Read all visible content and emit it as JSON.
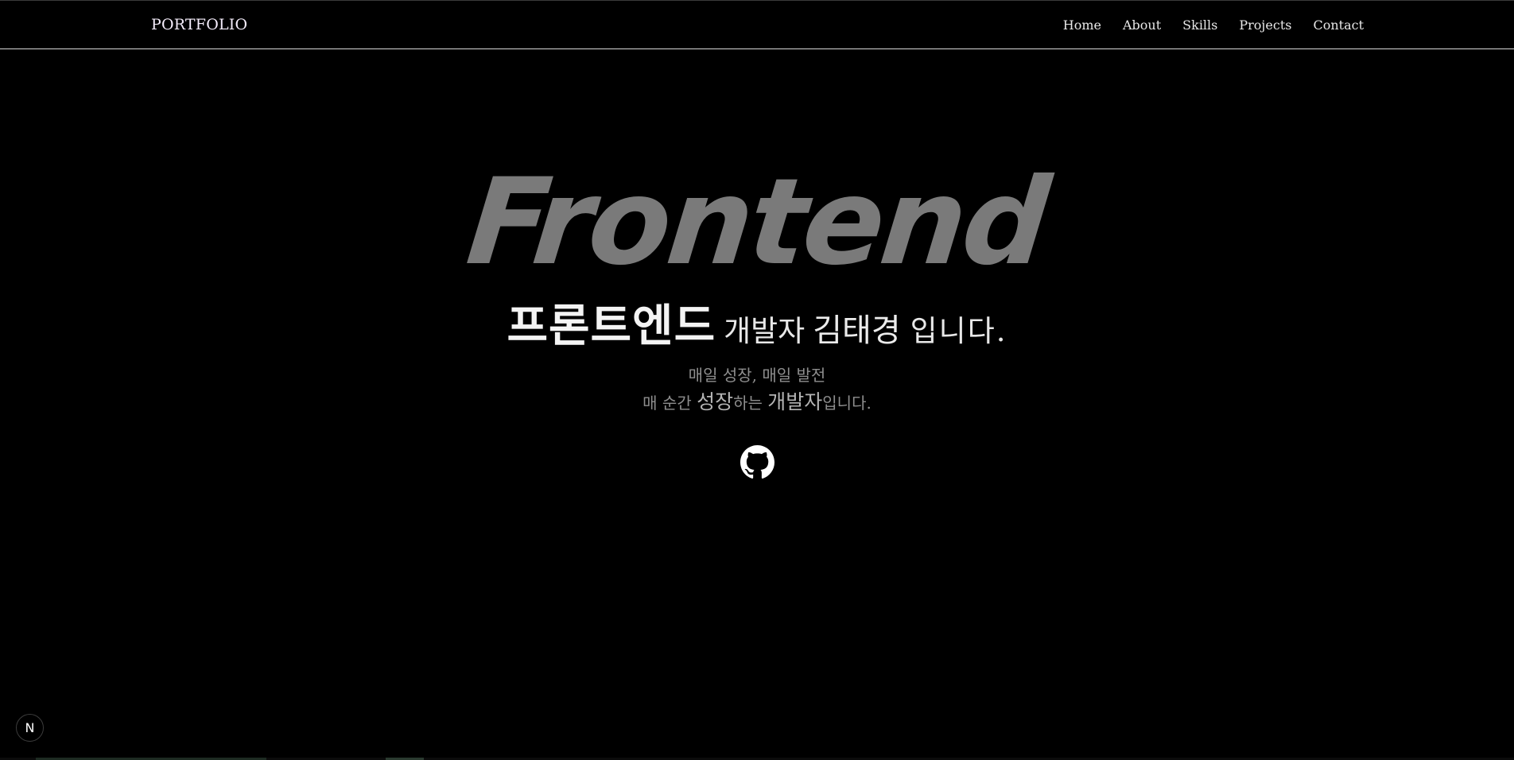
{
  "header": {
    "brand": "PORTFOLIO",
    "nav": [
      {
        "label": "Home"
      },
      {
        "label": "About"
      },
      {
        "label": "Skills"
      },
      {
        "label": "Projects"
      },
      {
        "label": "Contact"
      }
    ]
  },
  "hero": {
    "big_word": "Frontend",
    "headline": {
      "strong": "프론트엔드",
      "mid": "개발자",
      "name": "김태경",
      "end": "입니다."
    },
    "sub1": "매일 성장, 매일 발전",
    "sub2": {
      "a": "매 순간 ",
      "b": "성장",
      "c": "하는 ",
      "d": "개발자",
      "e": "입니다."
    },
    "github_icon": "github-icon"
  },
  "badge": {
    "label": "N"
  },
  "colors": {
    "background": "#000000",
    "big_word": "#7a7a7a",
    "subtext": "#8e8e8e"
  }
}
